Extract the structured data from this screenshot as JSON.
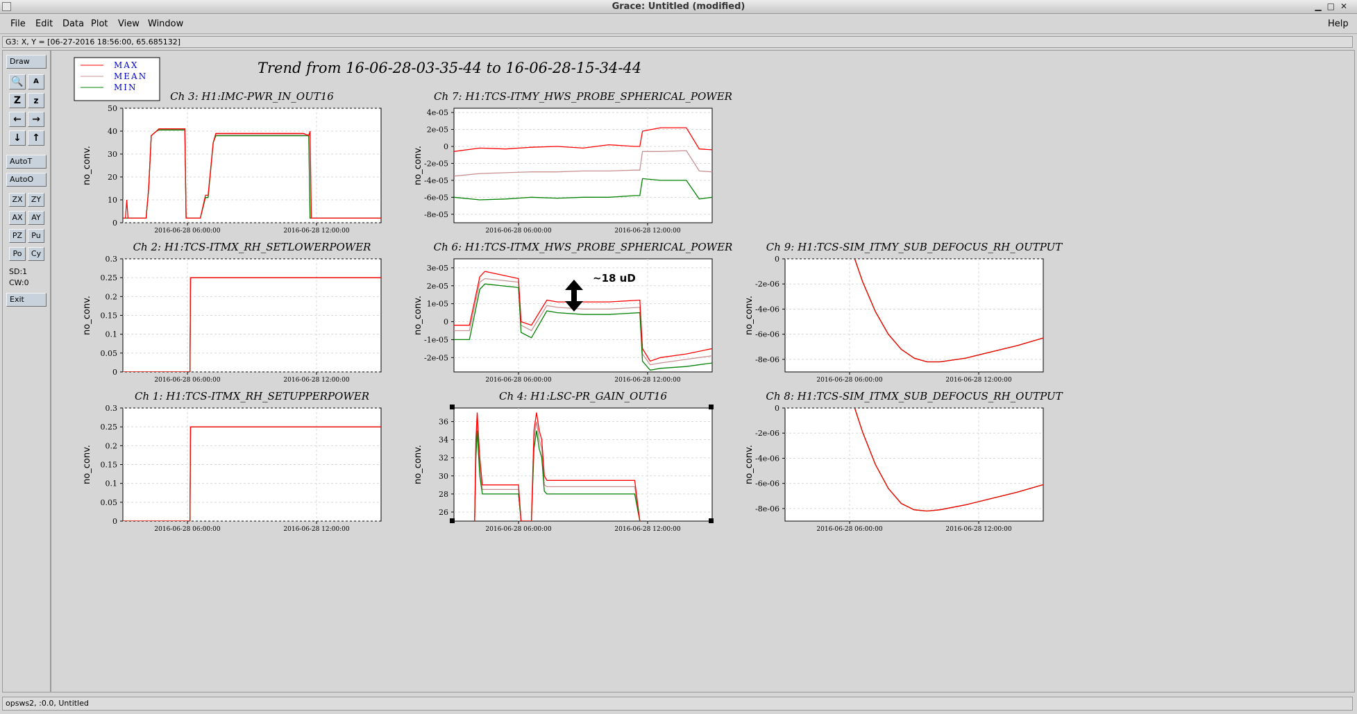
{
  "window": {
    "title": "Grace: Untitled (modified)"
  },
  "menu": [
    "File",
    "Edit",
    "Data",
    "Plot",
    "View",
    "Window"
  ],
  "menu_help": "Help",
  "locator": "G3: X, Y = [06-27-2016 18:56:00, 65.685132]",
  "toolbar": {
    "draw": "Draw",
    "autot": "AutoT",
    "autoo": "AutoO",
    "small_buttons": [
      "ZX",
      "ZY",
      "AX",
      "AY",
      "PZ",
      "Pu",
      "Po",
      "Cy"
    ],
    "sd": "SD:1",
    "cw": "CW:0",
    "exit": "Exit"
  },
  "status": "opsws2, :0.0, Untitled",
  "main_title": "Trend from 16-06-28-03-35-44 to 16-06-28-15-34-44",
  "legend": [
    "MAX",
    "MEAN",
    "MIN"
  ],
  "colors": {
    "max": "#ff0000",
    "mean": "#c89090",
    "min": "#008000",
    "annotation": "#000000"
  },
  "annotation": "~18 uD",
  "chart_data": [
    {
      "type": "line",
      "title": "Ch 3: H1:IMC-PWR_IN_OUT16",
      "ylabel": "no_conv.",
      "ylim": [
        0,
        50
      ],
      "yticks": [
        "0",
        "10",
        "20",
        "30",
        "40",
        "50"
      ],
      "xticks": [
        "2016-06-28 06:00:00",
        "2016-06-28 12:00:00"
      ],
      "series": [
        {
          "name": "MAX",
          "x": [
            0,
            0.01,
            0.015,
            0.02,
            0.09,
            0.1,
            0.11,
            0.13,
            0.14,
            0.24,
            0.245,
            0.25,
            0.3,
            0.32,
            0.33,
            0.35,
            0.36,
            0.7,
            0.72,
            0.725,
            0.73,
            1
          ],
          "y": [
            2,
            2,
            10,
            2,
            2,
            15,
            38,
            40,
            41,
            41,
            2,
            2,
            2,
            12,
            12,
            35,
            39,
            39,
            38,
            40,
            2,
            2
          ]
        },
        {
          "name": "MEAN",
          "x": [
            0,
            0.09,
            0.1,
            0.11,
            0.13,
            0.14,
            0.24,
            0.245,
            0.3,
            0.32,
            0.33,
            0.35,
            0.36,
            0.72,
            0.725,
            1
          ],
          "y": [
            2,
            2,
            15,
            38,
            40,
            41,
            41,
            2,
            2,
            11,
            11,
            35,
            38.5,
            38.5,
            2,
            2
          ]
        },
        {
          "name": "MIN",
          "x": [
            0,
            0.09,
            0.1,
            0.11,
            0.13,
            0.14,
            0.24,
            0.245,
            0.3,
            0.32,
            0.33,
            0.35,
            0.36,
            0.72,
            0.725,
            1
          ],
          "y": [
            2,
            2,
            15,
            38,
            40,
            40.5,
            40.5,
            2,
            2,
            11,
            11,
            35,
            38,
            38,
            2,
            2
          ]
        }
      ]
    },
    {
      "type": "line",
      "title": "Ch 7: H1:TCS-ITMY_HWS_PROBE_SPHERICAL_POWER",
      "ylabel": "no_conv.",
      "ylim": [
        -9e-05,
        4.5e-05
      ],
      "yticks": [
        "-8e-05",
        "-6e-05",
        "-4e-05",
        "-2e-05",
        "0",
        "2e-05",
        "4e-05"
      ],
      "xticks": [
        "2016-06-28 06:00:00",
        "2016-06-28 12:00:00"
      ],
      "series": [
        {
          "name": "MAX",
          "x": [
            0,
            0.1,
            0.2,
            0.3,
            0.4,
            0.5,
            0.6,
            0.7,
            0.72,
            0.73,
            0.8,
            0.9,
            0.95,
            1
          ],
          "y": [
            -6e-06,
            -2e-06,
            -3e-06,
            -1e-06,
            0,
            -2e-06,
            2e-06,
            0,
            0,
            1.8e-05,
            2.2e-05,
            2.2e-05,
            -3e-06,
            -4e-06
          ]
        },
        {
          "name": "MEAN",
          "x": [
            0,
            0.1,
            0.2,
            0.3,
            0.4,
            0.5,
            0.6,
            0.7,
            0.72,
            0.73,
            0.8,
            0.9,
            0.95,
            1
          ],
          "y": [
            -3.5e-05,
            -3.2e-05,
            -3.1e-05,
            -3e-05,
            -3e-05,
            -2.9e-05,
            -2.9e-05,
            -2.8e-05,
            -2.8e-05,
            -6e-06,
            -6e-06,
            -5e-06,
            -2.9e-05,
            -3e-05
          ]
        },
        {
          "name": "MIN",
          "x": [
            0,
            0.1,
            0.2,
            0.3,
            0.4,
            0.5,
            0.6,
            0.7,
            0.72,
            0.73,
            0.8,
            0.9,
            0.95,
            1
          ],
          "y": [
            -6e-05,
            -6.3e-05,
            -6.2e-05,
            -6e-05,
            -6.1e-05,
            -6e-05,
            -6e-05,
            -5.8e-05,
            -5.8e-05,
            -3.8e-05,
            -4e-05,
            -4e-05,
            -6.2e-05,
            -6e-05
          ]
        }
      ]
    },
    {
      "type": "line",
      "title": "Ch 2: H1:TCS-ITMX_RH_SETLOWERPOWER",
      "ylabel": "no_conv.",
      "ylim": [
        0,
        0.3
      ],
      "yticks": [
        "0",
        "0.05",
        "0.1",
        "0.15",
        "0.2",
        "0.25",
        "0.3"
      ],
      "xticks": [
        "2016-06-28 06:00:00",
        "2016-06-28 12:00:00"
      ],
      "series": [
        {
          "name": "MAX",
          "x": [
            0,
            0.26,
            0.262,
            1
          ],
          "y": [
            0,
            0,
            0.25,
            0.25
          ]
        },
        {
          "name": "MEAN",
          "x": [
            0,
            0.26,
            0.262,
            1
          ],
          "y": [
            0,
            0,
            0.25,
            0.25
          ]
        },
        {
          "name": "MIN",
          "x": [
            0,
            0.26,
            0.262,
            1
          ],
          "y": [
            0,
            0,
            0.25,
            0.25
          ]
        }
      ]
    },
    {
      "type": "line",
      "title": "Ch 6: H1:TCS-ITMX_HWS_PROBE_SPHERICAL_POWER",
      "ylabel": "no_conv.",
      "ylim": [
        -2.8e-05,
        3.5e-05
      ],
      "yticks": [
        "-2e-05",
        "-1e-05",
        "0",
        "1e-05",
        "2e-05",
        "3e-05"
      ],
      "xticks": [
        "2016-06-28 06:00:00",
        "2016-06-28 12:00:00"
      ],
      "series": [
        {
          "name": "MAX",
          "x": [
            0,
            0.06,
            0.1,
            0.12,
            0.25,
            0.26,
            0.3,
            0.36,
            0.4,
            0.5,
            0.6,
            0.72,
            0.73,
            0.76,
            0.8,
            0.9,
            1
          ],
          "y": [
            -2e-06,
            -2e-06,
            2.5e-05,
            2.8e-05,
            2.4e-05,
            0,
            -2e-06,
            1.2e-05,
            1.1e-05,
            1.1e-05,
            1.1e-05,
            1.2e-05,
            -1.5e-05,
            -2.2e-05,
            -2e-05,
            -1.8e-05,
            -1.5e-05
          ]
        },
        {
          "name": "MEAN",
          "x": [
            0,
            0.06,
            0.1,
            0.12,
            0.25,
            0.26,
            0.3,
            0.36,
            0.4,
            0.5,
            0.6,
            0.72,
            0.73,
            0.76,
            0.8,
            0.9,
            1
          ],
          "y": [
            -5e-06,
            -5e-06,
            2.2e-05,
            2.4e-05,
            2.2e-05,
            -2e-06,
            -5e-06,
            9e-06,
            8e-06,
            7e-06,
            7e-06,
            8e-06,
            -1.8e-05,
            -2.4e-05,
            -2.3e-05,
            -2.1e-05,
            -1.9e-05
          ]
        },
        {
          "name": "MIN",
          "x": [
            0,
            0.06,
            0.1,
            0.12,
            0.25,
            0.26,
            0.3,
            0.36,
            0.4,
            0.5,
            0.6,
            0.72,
            0.73,
            0.76,
            0.8,
            0.9,
            1
          ],
          "y": [
            -1e-05,
            -1e-05,
            1.8e-05,
            2.1e-05,
            1.9e-05,
            -6e-06,
            -9e-06,
            6e-06,
            5e-06,
            4e-06,
            4e-06,
            5e-06,
            -2.2e-05,
            -2.7e-05,
            -2.6e-05,
            -2.5e-05,
            -2.3e-05
          ]
        }
      ]
    },
    {
      "type": "line",
      "title": "Ch 9: H1:TCS-SIM_ITMY_SUB_DEFOCUS_RH_OUTPUT",
      "ylabel": "no_conv.",
      "ylim": [
        -9e-06,
        0
      ],
      "yticks": [
        "-8e-06",
        "-6e-06",
        "-4e-06",
        "-2e-06",
        "0"
      ],
      "xticks": [
        "2016-06-28 06:00:00",
        "2016-06-28 12:00:00"
      ],
      "series": [
        {
          "name": "MAX",
          "x": [
            0.27,
            0.3,
            0.35,
            0.4,
            0.45,
            0.5,
            0.55,
            0.6,
            0.7,
            0.8,
            0.9,
            1
          ],
          "y": [
            0,
            -1.8e-06,
            -4.2e-06,
            -6e-06,
            -7.2e-06,
            -7.9e-06,
            -8.2e-06,
            -8.2e-06,
            -7.9e-06,
            -7.4e-06,
            -6.9e-06,
            -6.3e-06
          ]
        },
        {
          "name": "MEAN",
          "x": [
            0.27,
            0.3,
            0.35,
            0.4,
            0.45,
            0.5,
            0.55,
            0.6,
            0.7,
            0.8,
            0.9,
            1
          ],
          "y": [
            0,
            -1.8e-06,
            -4.2e-06,
            -6e-06,
            -7.2e-06,
            -7.9e-06,
            -8.2e-06,
            -8.2e-06,
            -7.9e-06,
            -7.4e-06,
            -6.9e-06,
            -6.3e-06
          ]
        },
        {
          "name": "MIN",
          "x": [
            0.27,
            0.3,
            0.35,
            0.4,
            0.45,
            0.5,
            0.55,
            0.6,
            0.7,
            0.8,
            0.9,
            1
          ],
          "y": [
            0,
            -1.8e-06,
            -4.2e-06,
            -6e-06,
            -7.2e-06,
            -7.9e-06,
            -8.2e-06,
            -8.2e-06,
            -7.9e-06,
            -7.4e-06,
            -6.9e-06,
            -6.3e-06
          ]
        }
      ]
    },
    {
      "type": "line",
      "title": "Ch 1: H1:TCS-ITMX_RH_SETUPPERPOWER",
      "ylabel": "no_conv.",
      "ylim": [
        0,
        0.3
      ],
      "yticks": [
        "0",
        "0.05",
        "0.1",
        "0.15",
        "0.2",
        "0.25",
        "0.3"
      ],
      "xticks": [
        "2016-06-28 06:00:00",
        "2016-06-28 12:00:00"
      ],
      "series": [
        {
          "name": "MAX",
          "x": [
            0,
            0.26,
            0.262,
            1
          ],
          "y": [
            0,
            0,
            0.25,
            0.25
          ]
        },
        {
          "name": "MEAN",
          "x": [
            0,
            0.26,
            0.262,
            1
          ],
          "y": [
            0,
            0,
            0.25,
            0.25
          ]
        },
        {
          "name": "MIN",
          "x": [
            0,
            0.26,
            0.262,
            1
          ],
          "y": [
            0,
            0,
            0.25,
            0.25
          ]
        }
      ]
    },
    {
      "type": "line",
      "title": "Ch 4: H1:LSC-PR_GAIN_OUT16",
      "ylabel": "no_conv.",
      "ylim": [
        25,
        37.5
      ],
      "yticks": [
        "26",
        "28",
        "30",
        "32",
        "34",
        "36"
      ],
      "xticks": [
        "2016-06-28 06:00:00",
        "2016-06-28 12:00:00"
      ],
      "series": [
        {
          "name": "MAX",
          "x": [
            0.08,
            0.085,
            0.09,
            0.1,
            0.11,
            0.25,
            0.26,
            0.3,
            0.31,
            0.32,
            0.33,
            0.34,
            0.35,
            0.36,
            0.7,
            0.72
          ],
          "y": [
            25,
            34,
            37,
            32,
            29,
            29,
            25,
            25,
            35,
            37,
            35,
            34,
            30,
            29.5,
            29.5,
            25
          ]
        },
        {
          "name": "MEAN",
          "x": [
            0.08,
            0.085,
            0.09,
            0.1,
            0.11,
            0.25,
            0.26,
            0.3,
            0.31,
            0.32,
            0.33,
            0.34,
            0.35,
            0.36,
            0.7,
            0.72
          ],
          "y": [
            25,
            33,
            36,
            31,
            28.5,
            28.5,
            25,
            25,
            34,
            36,
            34,
            33,
            29,
            28.8,
            28.8,
            25
          ]
        },
        {
          "name": "MIN",
          "x": [
            0.08,
            0.085,
            0.09,
            0.1,
            0.11,
            0.25,
            0.26,
            0.3,
            0.31,
            0.32,
            0.33,
            0.34,
            0.35,
            0.36,
            0.7,
            0.72
          ],
          "y": [
            25,
            32,
            35,
            30,
            28,
            28,
            25,
            25,
            33,
            35,
            33,
            32,
            28.3,
            28,
            28,
            25
          ]
        }
      ]
    },
    {
      "type": "line",
      "title": "Ch 8: H1:TCS-SIM_ITMX_SUB_DEFOCUS_RH_OUTPUT",
      "ylabel": "no_conv.",
      "ylim": [
        -9e-06,
        0
      ],
      "yticks": [
        "-8e-06",
        "-6e-06",
        "-4e-06",
        "-2e-06",
        "0"
      ],
      "xticks": [
        "2016-06-28 06:00:00",
        "2016-06-28 12:00:00"
      ],
      "series": [
        {
          "name": "MAX",
          "x": [
            0.27,
            0.3,
            0.35,
            0.4,
            0.45,
            0.5,
            0.55,
            0.6,
            0.7,
            0.8,
            0.9,
            1
          ],
          "y": [
            0,
            -1.9e-06,
            -4.5e-06,
            -6.4e-06,
            -7.6e-06,
            -8.1e-06,
            -8.2e-06,
            -8.1e-06,
            -7.7e-06,
            -7.2e-06,
            -6.7e-06,
            -6.1e-06
          ]
        },
        {
          "name": "MEAN",
          "x": [
            0.27,
            0.3,
            0.35,
            0.4,
            0.45,
            0.5,
            0.55,
            0.6,
            0.7,
            0.8,
            0.9,
            1
          ],
          "y": [
            0,
            -1.9e-06,
            -4.5e-06,
            -6.4e-06,
            -7.6e-06,
            -8.1e-06,
            -8.2e-06,
            -8.1e-06,
            -7.7e-06,
            -7.2e-06,
            -6.7e-06,
            -6.1e-06
          ]
        },
        {
          "name": "MIN",
          "x": [
            0.27,
            0.3,
            0.35,
            0.4,
            0.45,
            0.5,
            0.55,
            0.6,
            0.7,
            0.8,
            0.9,
            1
          ],
          "y": [
            0,
            -1.9e-06,
            -4.5e-06,
            -6.4e-06,
            -7.6e-06,
            -8.1e-06,
            -8.2e-06,
            -8.1e-06,
            -7.7e-06,
            -7.2e-06,
            -6.7e-06,
            -6.1e-06
          ]
        }
      ]
    }
  ]
}
